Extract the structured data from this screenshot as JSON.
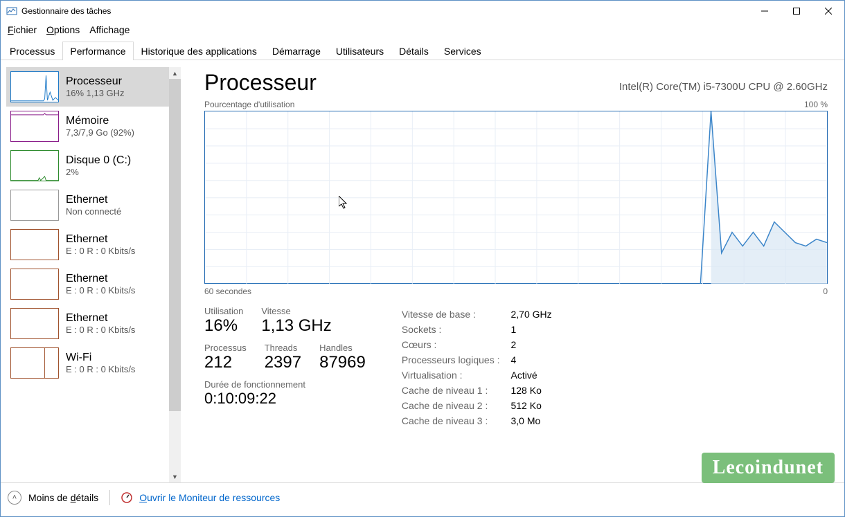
{
  "window": {
    "title": "Gestionnaire des tâches"
  },
  "menu": [
    "Fichier",
    "Options",
    "Affichage"
  ],
  "tabs": [
    "Processus",
    "Performance",
    "Historique des applications",
    "Démarrage",
    "Utilisateurs",
    "Détails",
    "Services"
  ],
  "active_tab_index": 1,
  "sidebar": [
    {
      "title": "Processeur",
      "sub": "16%  1,13 GHz",
      "color": "#1e7ac8",
      "selected": true
    },
    {
      "title": "Mémoire",
      "sub": "7,3/7,9 Go (92%)",
      "color": "#8a1d8a"
    },
    {
      "title": "Disque 0 (C:)",
      "sub": "2%",
      "color": "#2e8b2e"
    },
    {
      "title": "Ethernet",
      "sub": "Non connecté",
      "color": "#999999"
    },
    {
      "title": "Ethernet",
      "sub": "E : 0 R : 0 Kbits/s",
      "color": "#a0522d"
    },
    {
      "title": "Ethernet",
      "sub": "E : 0 R : 0 Kbits/s",
      "color": "#a0522d"
    },
    {
      "title": "Ethernet",
      "sub": "E : 0 R : 0 Kbits/s",
      "color": "#a0522d"
    },
    {
      "title": "Wi-Fi",
      "sub": "E : 0 R : 0 Kbits/s",
      "color": "#a0522d"
    }
  ],
  "details": {
    "title": "Processeur",
    "subtitle": "Intel(R) Core(TM) i5-7300U CPU @ 2.60GHz",
    "chart_top_left": "Pourcentage d'utilisation",
    "chart_top_right": "100 %",
    "chart_bottom_left": "60 secondes",
    "chart_bottom_right": "0",
    "left_stats": {
      "util_label": "Utilisation",
      "util_value": "16%",
      "speed_label": "Vitesse",
      "speed_value": "1,13 GHz",
      "proc_label": "Processus",
      "proc_value": "212",
      "threads_label": "Threads",
      "threads_value": "2397",
      "handles_label": "Handles",
      "handles_value": "87969",
      "uptime_label": "Durée de fonctionnement",
      "uptime_value": "0:10:09:22"
    },
    "right_stats": [
      [
        "Vitesse de base :",
        "2,70 GHz"
      ],
      [
        "Sockets :",
        "1"
      ],
      [
        "Cœurs :",
        "2"
      ],
      [
        "Processeurs logiques :",
        "4"
      ],
      [
        "Virtualisation :",
        "Activé"
      ],
      [
        "Cache de niveau 1 :",
        "128 Ko"
      ],
      [
        "Cache de niveau 2 :",
        "512 Ko"
      ],
      [
        "Cache de niveau 3 :",
        "3,0 Mo"
      ]
    ]
  },
  "footer": {
    "less": "Moins de détails",
    "link": "Ouvrir le Moniteur de ressources"
  },
  "watermark": "Lecoindunet",
  "chart_data": {
    "type": "line",
    "title": "Pourcentage d'utilisation",
    "xlabel": "60 secondes",
    "ylabel": "",
    "ylim": [
      0,
      100
    ],
    "x_range_seconds": [
      60,
      0
    ],
    "values_pct": [
      0,
      0,
      0,
      0,
      0,
      0,
      0,
      0,
      0,
      0,
      0,
      0,
      0,
      0,
      0,
      0,
      0,
      0,
      0,
      0,
      0,
      0,
      0,
      0,
      0,
      0,
      0,
      0,
      0,
      0,
      0,
      0,
      0,
      0,
      0,
      0,
      0,
      0,
      0,
      0,
      0,
      0,
      0,
      0,
      0,
      0,
      0,
      0,
      100,
      18,
      30,
      22,
      30,
      22,
      36,
      30,
      24,
      22,
      26,
      24
    ]
  }
}
